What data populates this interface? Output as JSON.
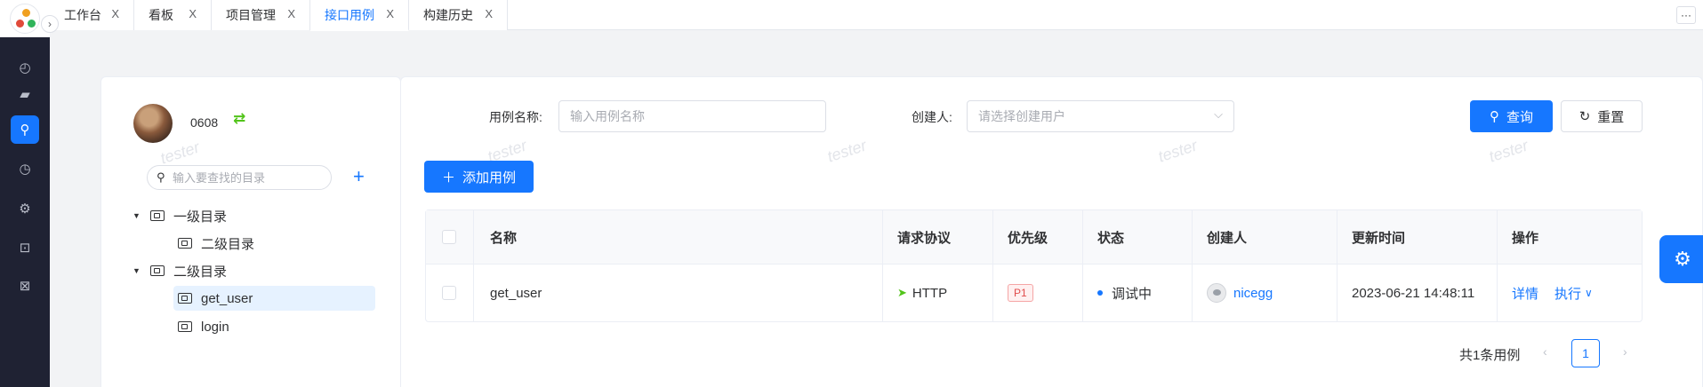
{
  "rail": {
    "items": [
      {
        "name": "dashboard-icon",
        "glyph": "◴"
      },
      {
        "name": "folder-icon",
        "glyph": "▰"
      },
      {
        "name": "api-link-icon",
        "glyph": "⚲"
      },
      {
        "name": "history-icon",
        "glyph": "◷"
      },
      {
        "name": "gear-icon",
        "glyph": "⚙"
      },
      {
        "name": "lock-icon",
        "glyph": "⊡"
      },
      {
        "name": "mail-icon",
        "glyph": "⊠"
      }
    ]
  },
  "tabs": [
    {
      "label": "工作台"
    },
    {
      "label": "看板"
    },
    {
      "label": "项目管理"
    },
    {
      "label": "接口用例",
      "active": true
    },
    {
      "label": "构建历史"
    }
  ],
  "tab_close": "X",
  "more_label": "···",
  "user": {
    "name": "0608"
  },
  "tree": {
    "search_placeholder": "输入要查找的目录",
    "nodes": [
      {
        "label": "一级目录",
        "expanded": true
      },
      {
        "label": "二级目录"
      },
      {
        "label": "二级目录",
        "expanded": true
      },
      {
        "label": "get_user",
        "selected": true
      },
      {
        "label": "login"
      }
    ]
  },
  "filters": {
    "case_name_label": "用例名称:",
    "case_name_placeholder": "输入用例名称",
    "creator_label": "创建人:",
    "creator_placeholder": "请选择创建用户",
    "query_label": "查询",
    "reset_label": "重置",
    "add_label": "添加用例"
  },
  "watermark": "tester",
  "table": {
    "headers": [
      "名称",
      "请求协议",
      "优先级",
      "状态",
      "创建人",
      "更新时间",
      "操作"
    ],
    "rows": [
      {
        "name": "get_user",
        "protocol": "HTTP",
        "priority": "P1",
        "status": "调试中",
        "creator": "nicegg",
        "updated": "2023-06-21 14:48:11",
        "action_detail": "详情",
        "action_run": "执行"
      }
    ]
  },
  "pagination": {
    "summary": "共1条用例",
    "current": "1"
  },
  "colors": {
    "primary": "#1677ff",
    "rail": "#1f2233",
    "success": "#52c41a",
    "danger": "#e14c4c"
  }
}
